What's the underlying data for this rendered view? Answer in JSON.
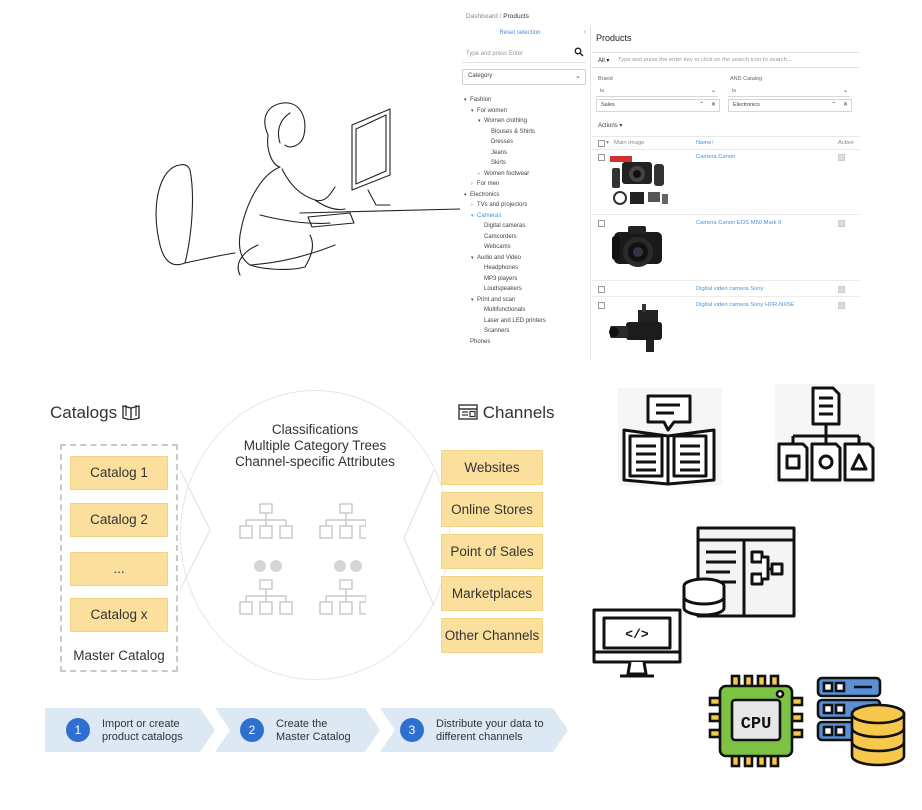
{
  "admin": {
    "breadcrumb_root": "Dashboard",
    "breadcrumb_sep": "/",
    "breadcrumb_current": "Products",
    "reset_selection": "Reset selection",
    "sidebar_search_placeholder": "Type and press Enter",
    "category_select": "Category",
    "tree": [
      {
        "label": "Fashion",
        "level": 0,
        "toggle": "▾",
        "blue": false
      },
      {
        "label": "For women",
        "level": 1,
        "toggle": "▾",
        "blue": false
      },
      {
        "label": "Women clothing",
        "level": 2,
        "toggle": "▾",
        "blue": false
      },
      {
        "label": "Blouses & Shirts",
        "level": 3,
        "toggle": "",
        "blue": false
      },
      {
        "label": "Dresses",
        "level": 3,
        "toggle": "",
        "blue": false
      },
      {
        "label": "Jeans",
        "level": 3,
        "toggle": "",
        "blue": false
      },
      {
        "label": "Skirts",
        "level": 3,
        "toggle": "",
        "blue": false
      },
      {
        "label": "Women footwear",
        "level": 2,
        "toggle": "›",
        "blue": false
      },
      {
        "label": "For men",
        "level": 1,
        "toggle": "›",
        "blue": false
      },
      {
        "label": "Electronics",
        "level": 0,
        "toggle": "▾",
        "blue": false
      },
      {
        "label": "TVs and projectors",
        "level": 1,
        "toggle": "›",
        "blue": false
      },
      {
        "label": "Cameras",
        "level": 1,
        "toggle": "▾",
        "blue": true
      },
      {
        "label": "Digital cameras",
        "level": 2,
        "toggle": "",
        "blue": false
      },
      {
        "label": "Camcorders",
        "level": 2,
        "toggle": "",
        "blue": false
      },
      {
        "label": "Webcams",
        "level": 2,
        "toggle": "",
        "blue": false
      },
      {
        "label": "Audio and Video",
        "level": 1,
        "toggle": "▾",
        "blue": false
      },
      {
        "label": "Headphones",
        "level": 2,
        "toggle": "",
        "blue": false
      },
      {
        "label": "MP3 players",
        "level": 2,
        "toggle": "",
        "blue": false
      },
      {
        "label": "Loudspeakers",
        "level": 2,
        "toggle": "",
        "blue": false
      },
      {
        "label": "Print and scan",
        "level": 1,
        "toggle": "▾",
        "blue": false
      },
      {
        "label": "Multifunctionals",
        "level": 2,
        "toggle": "",
        "blue": false
      },
      {
        "label": "Laser and LED printers",
        "level": 2,
        "toggle": "",
        "blue": false
      },
      {
        "label": "Scanners",
        "level": 2,
        "toggle": "",
        "blue": false
      },
      {
        "label": "Phones",
        "level": 0,
        "toggle": "",
        "blue": false
      }
    ],
    "page_title": "Products",
    "search_scope": "All ▾",
    "search_placeholder": "Type and press the enter key or click on the search icon to search...",
    "filter1": {
      "label": "Brand",
      "op": "is",
      "value": "Sales"
    },
    "filter2": {
      "label": "AND Catalog",
      "op": "is",
      "value": "Electronics"
    },
    "actions": "Actions ▾",
    "columns": {
      "image": "Main Image",
      "name": "Name↑",
      "active": "Active"
    },
    "products": [
      {
        "name": "Camera Canon"
      },
      {
        "name": "Camera Canon EOS M50 Mark II"
      },
      {
        "name": "Digital video camera Sony"
      },
      {
        "name": "Digital video camera Sony HXR-NX5E"
      }
    ]
  },
  "diagram": {
    "catalogs_title": "Catalogs",
    "channels_title": "Channels",
    "catalogs": [
      "Catalog 1",
      "Catalog 2",
      "...",
      "Catalog x"
    ],
    "master_label": "Master Catalog",
    "center_lines": [
      "Classifications",
      "Multiple Category Trees",
      "Channel-specific Attributes"
    ],
    "channels": [
      "Websites",
      "Online Stores",
      "Point of Sales",
      "Marketplaces",
      "Other Channels"
    ],
    "steps": [
      {
        "num": "1",
        "line1": "Import or create",
        "line2": "product catalogs"
      },
      {
        "num": "2",
        "line1": "Create the",
        "line2": "Master Catalog"
      },
      {
        "num": "3",
        "line1": "Distribute your data to",
        "line2": "different channels"
      }
    ]
  },
  "icons": {
    "cpu_label": "CPU",
    "code_label": "</>"
  },
  "colors": {
    "card_yellow": "#fbe09d",
    "step_blue": "#2f6fcf",
    "link_blue": "#4a90d9",
    "step_band": "#dde8f5"
  }
}
